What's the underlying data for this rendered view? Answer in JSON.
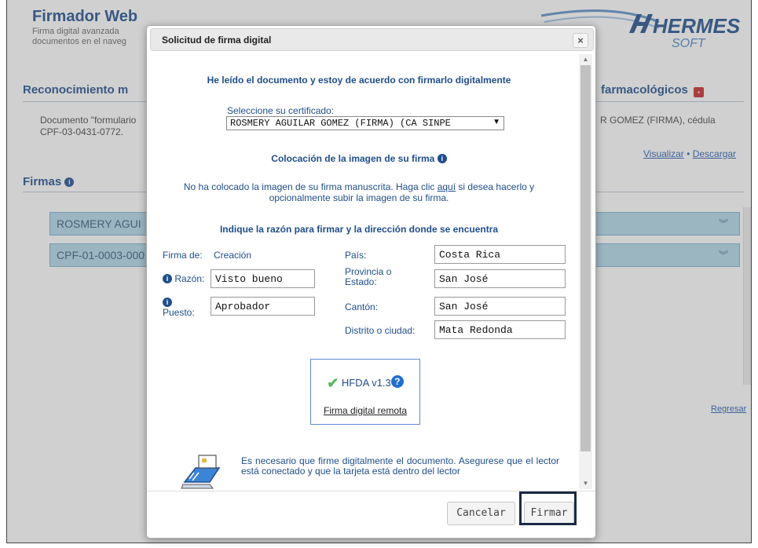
{
  "app": {
    "title": "Firmador Web",
    "subtitle_line1": "Firma digital avanzada",
    "subtitle_line2": "documentos en el naveg",
    "logo_text1": "HERMES",
    "logo_text2": "SOFT"
  },
  "background": {
    "section_title": "Reconocimiento m",
    "section_title_right": "farmacológicos",
    "doc_text_left": "Documento \"formulario",
    "doc_text_left2": "CPF-03-0431-0772.",
    "doc_text_right": "R GOMEZ (FIRMA), cédula",
    "visualize_link": "Visualizar",
    "separator": "•",
    "download_link": "Descargar",
    "firmas_title": "Firmas",
    "accordion_items": [
      "ROSMERY AGUI",
      "CPF-01-0003-000"
    ],
    "back_link": "Regresar"
  },
  "dialog": {
    "title": "Solicitud de firma digital",
    "close_label": "×",
    "agree_text": "He leído el documento y estoy de acuerdo con firmarlo digitalmente",
    "cert_label": "Seleccione su certificado:",
    "cert_value": "ROSMERY AGUILAR GOMEZ (FIRMA) (CA SINPE",
    "image_heading": "Colocación de la imagen de su firma",
    "notice_part1": "No ha colocado la imagen de su firma manuscrita. Haga clic ",
    "notice_link": "aquí",
    "notice_part2": " si desea hacerlo y",
    "notice_line2": "opcionalmente subir la imagen de su firma.",
    "reason_heading": "Indique la razón para firmar y la dirección donde se encuentra",
    "fields": {
      "firma_de_label": "Firma de:",
      "firma_de_value": "Creación",
      "razon_label": "Razón:",
      "razon_value": "Visto bueno",
      "puesto_label": "Puesto:",
      "puesto_value": "Aprobador",
      "pais_label": "País:",
      "pais_value": "Costa Rica",
      "provincia_label1": "Provincia o",
      "provincia_label2": "Estado:",
      "provincia_value": "San José",
      "canton_label": "Cantón:",
      "canton_value": "San José",
      "distrito_label": "Distrito o ciudad:",
      "distrito_value": "Mata Redonda"
    },
    "hfda_label": "HFDA v1.3",
    "hfda_link": "Firma digital remota",
    "reader_text": "Es necesario que firme digitalmente el documento. Asegurese que el lector está conectado y que la tarjeta está dentro del lector",
    "cancel_button": "Cancelar",
    "sign_button": "Firmar"
  },
  "colors": {
    "accent": "#1f4e8c",
    "accordion": "#b2d7e9",
    "hfda_border": "#5b8ad3",
    "highlight_outline": "#1b2a44"
  }
}
